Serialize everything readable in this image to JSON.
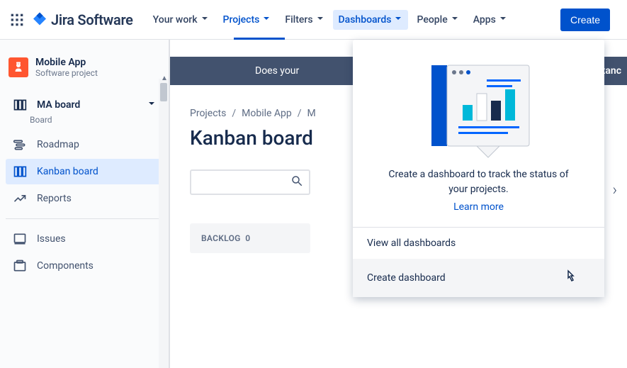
{
  "topnav": {
    "logo_text": "Jira Software",
    "items": [
      {
        "label": "Your work"
      },
      {
        "label": "Projects"
      },
      {
        "label": "Filters"
      },
      {
        "label": "Dashboards"
      },
      {
        "label": "People"
      },
      {
        "label": "Apps"
      }
    ],
    "create_label": "Create"
  },
  "sidebar": {
    "project_title": "Mobile App",
    "project_subtitle": "Software project",
    "board_title": "MA board",
    "board_subtitle": "Board",
    "items": [
      {
        "label": "Roadmap"
      },
      {
        "label": "Kanban board"
      },
      {
        "label": "Reports"
      }
    ],
    "bottom_items": [
      {
        "label": "Issues"
      },
      {
        "label": "Components"
      }
    ]
  },
  "main": {
    "banner_text": "Does your",
    "banner_right": "tanc",
    "breadcrumbs": [
      "Projects",
      "Mobile App",
      "M"
    ],
    "page_title": "Kanban board",
    "column_header": "BACKLOG",
    "column_count": "0"
  },
  "dropdown": {
    "desc": "Create a dashboard to track the status of your projects.",
    "learn_more": "Learn more",
    "items": [
      {
        "label": "View all dashboards"
      },
      {
        "label": "Create dashboard"
      }
    ]
  }
}
